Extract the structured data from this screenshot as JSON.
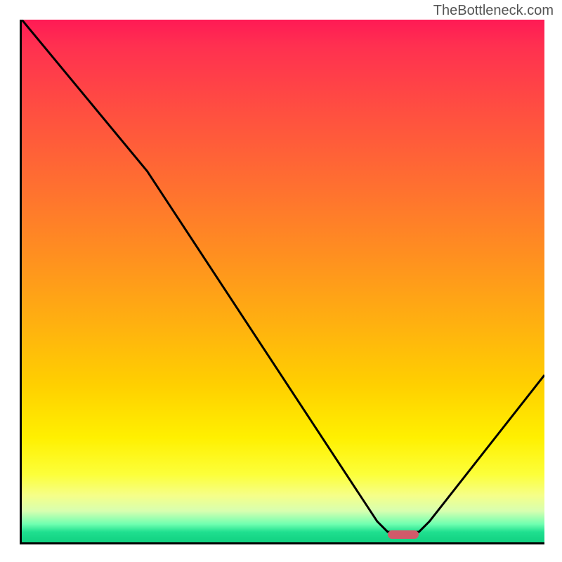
{
  "watermark": "TheBottleneck.com",
  "chart_data": {
    "type": "line",
    "title": "",
    "xlabel": "",
    "ylabel": "",
    "xrange": [
      0,
      100
    ],
    "yrange": [
      0,
      100
    ],
    "grid": false,
    "series": [
      {
        "name": "curve",
        "points": [
          {
            "x": 0,
            "y": 100
          },
          {
            "x": 24,
            "y": 71
          },
          {
            "x": 68,
            "y": 4
          },
          {
            "x": 70,
            "y": 2
          },
          {
            "x": 76,
            "y": 2
          },
          {
            "x": 78,
            "y": 4
          },
          {
            "x": 100,
            "y": 32
          }
        ]
      }
    ],
    "marker": {
      "x": 73,
      "y": 1.5,
      "width_pct": 6
    }
  },
  "colors": {
    "top": "#ff1a55",
    "mid": "#fff000",
    "bottom": "#10d080",
    "marker": "#d15a6a",
    "axis": "#000000"
  }
}
